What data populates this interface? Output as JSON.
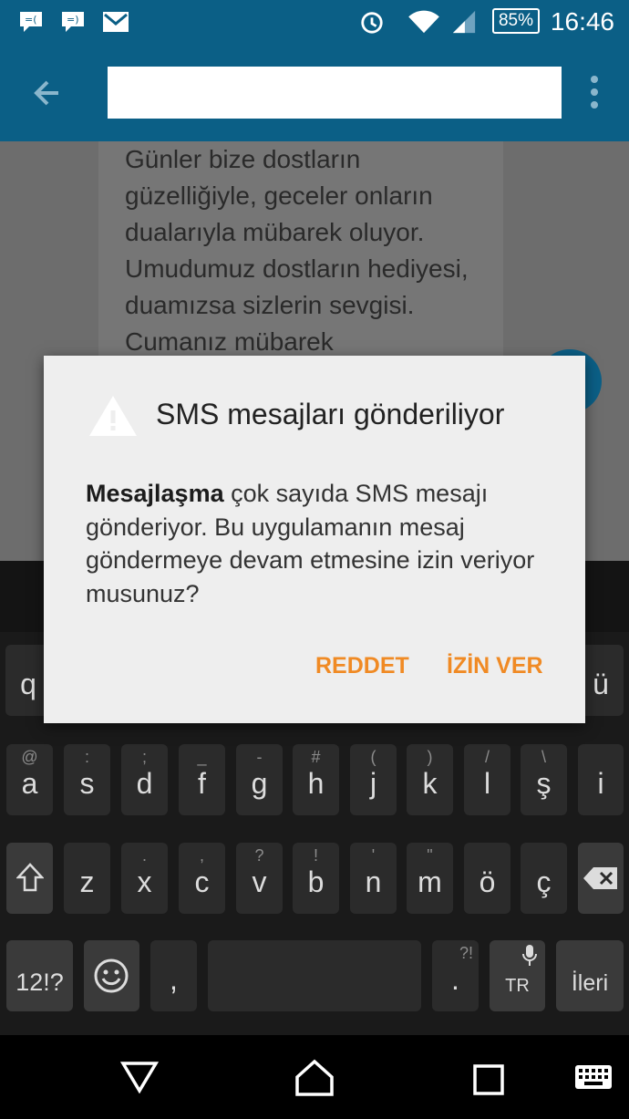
{
  "status_bar": {
    "battery": "85%",
    "time": "16:46"
  },
  "conversation": {
    "message_text": "Günler bize dostların güzelliğiyle, geceler onların dualarıyla mübarek oluyor. Umudumuz dostların hediyesi, duamızsa sizlerin sevgisi. Cumanız mübarek"
  },
  "dialog": {
    "title": "SMS mesajları gönderiliyor",
    "body_app": "Mesajlaşma",
    "body_text": " çok sayıda SMS mesajı gönderiyor. Bu uygulamanın mesaj göndermeye devam etmesine izin veriyor musunuz?",
    "deny_label": "REDDET",
    "allow_label": "İZİN VER"
  },
  "keyboard": {
    "row1": [
      {
        "main": "q",
        "alt": ""
      },
      {
        "main": "ü",
        "alt": ""
      }
    ],
    "row2": [
      {
        "main": "a",
        "alt": "@"
      },
      {
        "main": "s",
        "alt": ":"
      },
      {
        "main": "d",
        "alt": ";"
      },
      {
        "main": "f",
        "alt": "_"
      },
      {
        "main": "g",
        "alt": "-"
      },
      {
        "main": "h",
        "alt": "#"
      },
      {
        "main": "j",
        "alt": "("
      },
      {
        "main": "k",
        "alt": ")"
      },
      {
        "main": "l",
        "alt": "/"
      },
      {
        "main": "ş",
        "alt": "\\"
      },
      {
        "main": "i",
        "alt": ""
      }
    ],
    "row3": [
      {
        "main": "z",
        "alt": ""
      },
      {
        "main": "x",
        "alt": "."
      },
      {
        "main": "c",
        "alt": ","
      },
      {
        "main": "v",
        "alt": "?"
      },
      {
        "main": "b",
        "alt": "!"
      },
      {
        "main": "n",
        "alt": "'"
      },
      {
        "main": "m",
        "alt": "\""
      },
      {
        "main": "ö",
        "alt": ""
      },
      {
        "main": "ç",
        "alt": ""
      }
    ],
    "symbols_label": "12!?",
    "comma_label": ",",
    "period_label": ".",
    "period_alt": "?!",
    "lang_label": "TR",
    "enter_label": "İleri"
  },
  "icons": {
    "status_left": [
      "messaging-notification-icon",
      "messaging-notification-icon",
      "gmail-icon"
    ],
    "status_right": [
      "alarm-icon",
      "wifi-icon",
      "signal-icon",
      "battery-icon"
    ],
    "nav": [
      "back-triangle-icon",
      "home-icon",
      "recents-icon",
      "keyboard-icon"
    ]
  }
}
